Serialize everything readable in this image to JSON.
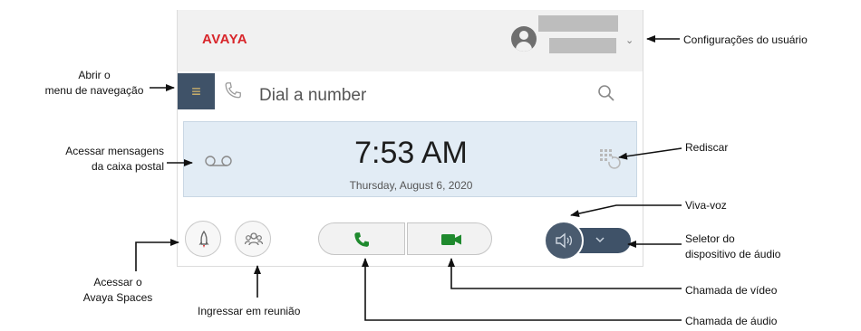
{
  "app": {
    "brand": "AVAYA",
    "dial_placeholder": "Dial a number",
    "time": "7:53 AM",
    "date": "Thursday, August 6, 2020"
  },
  "icons": {
    "menu": "hamburger-menu-icon",
    "handset": "phone-handset-icon",
    "search": "search-icon",
    "voicemail": "voicemail-icon",
    "redial": "redial-icon",
    "spaces": "avaya-spaces-icon",
    "meeting": "group-icon",
    "audio_call": "phone-icon",
    "video_call": "video-camera-icon",
    "speaker": "speaker-icon",
    "device_selector": "chevron-down-icon",
    "user": "user-avatar-icon"
  },
  "colors": {
    "brand_red": "#d8262b",
    "nav_dark": "#3f5268",
    "call_green": "#1f8a2e",
    "clock_panel": "#e2ecf5"
  },
  "annotations": {
    "user_settings": "Configurações do usuário",
    "nav_menu": [
      "Abrir o",
      "menu de navegação"
    ],
    "voicemail": [
      "Acessar mensagens",
      "da caixa postal"
    ],
    "redial": "Rediscar",
    "speaker": "Viva-voz",
    "device_selector": [
      "Seletor do",
      "dispositivo de áudio"
    ],
    "spaces": [
      "Acessar o",
      "Avaya Spaces"
    ],
    "meeting": "Ingressar em reunião",
    "video_call": "Chamada de vídeo",
    "audio_call": "Chamada de áudio"
  }
}
